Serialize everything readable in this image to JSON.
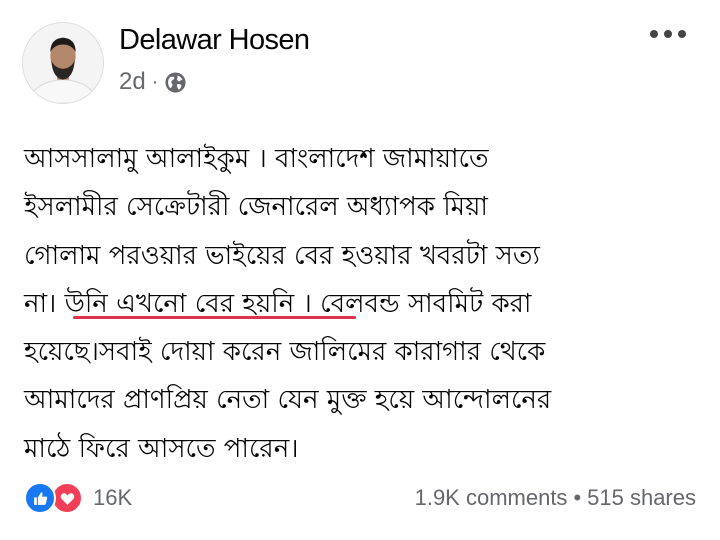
{
  "post": {
    "author": "Delawar Hosen",
    "time": "2d",
    "separator": "·",
    "privacy_icon": "globe-icon",
    "more_icon": "more-options-icon",
    "lines": [
      "আসসালামু আলাইকুম । বাংলাদেশ জামায়াতে",
      "ইসলামীর সেক্রেটারী জেনারেল অধ্যাপক মিয়া",
      "গোলাম পরওয়ার ভাইয়ের বের হওয়ার খবরটা সত্য",
      "না। উনি এখনো বের হয়নি । বেলবন্ড সাবমিট করা",
      "হয়েছে।সবাই দোয়া করেন জালিমের কারাগার থেকে",
      "আমাদের প্রাণপ্রিয় নেতা যেন মুক্ত হয়ে আন্দোলনের",
      "মাঠে ফিরে আসতে পারেন।"
    ]
  },
  "reactions": {
    "count": "16K",
    "icons": [
      "like-icon",
      "love-icon"
    ]
  },
  "stats": {
    "comments": "1.9K comments",
    "separator": "•",
    "shares": "515 shares"
  },
  "colors": {
    "like": "#1877f2",
    "love": "#f33e58",
    "underline": "#e0304e",
    "secondary_text": "#65676b"
  }
}
